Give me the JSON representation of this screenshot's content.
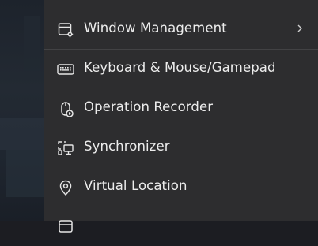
{
  "menu": {
    "items": [
      {
        "label": "Window Management",
        "icon": "window-settings-icon",
        "has_submenu": true
      },
      {
        "label": "Keyboard & Mouse/Gamepad",
        "icon": "keyboard-icon"
      },
      {
        "label": "Operation Recorder",
        "icon": "mouse-record-icon"
      },
      {
        "label": "Synchronizer",
        "icon": "synchronizer-icon"
      },
      {
        "label": "Virtual Location",
        "icon": "location-pin-icon"
      }
    ]
  },
  "colors": {
    "menu_background": "#2d2d2f",
    "text": "#ececec",
    "icon": "#e6e6e6",
    "divider": "#424244"
  }
}
